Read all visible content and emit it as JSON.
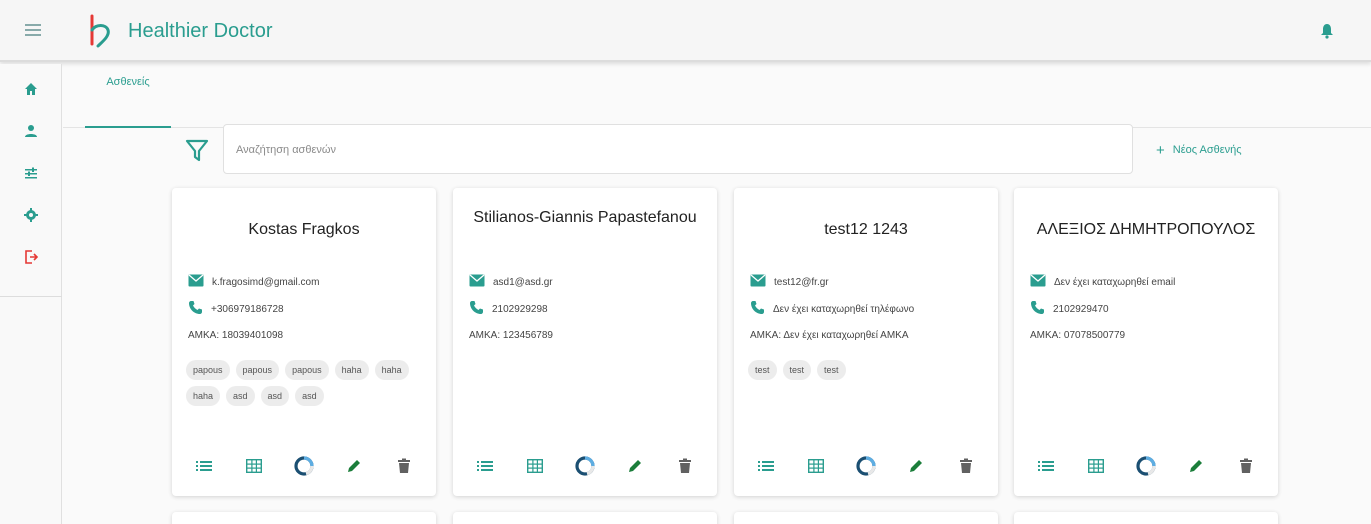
{
  "app": {
    "title": "Healthier Doctor"
  },
  "colors": {
    "accent": "#2a9d8f",
    "logout": "#e53935",
    "icon_gray": "#888888",
    "delete": "#616161",
    "edit": "#1b7d3a"
  },
  "icons": {
    "topbar": [
      "menu-icon",
      "logo-icon",
      "bell-icon"
    ],
    "sidebar": [
      "home-icon",
      "person-icon",
      "sliders-icon",
      "gear-icon",
      "logout-icon"
    ],
    "card_actions": [
      "list-icon",
      "table-icon",
      "progress-icon",
      "edit-icon",
      "delete-icon"
    ]
  },
  "tabs": [
    {
      "label": "Ασθενείς",
      "active": true
    }
  ],
  "search": {
    "placeholder": "Αναζήτηση ασθενών",
    "value": ""
  },
  "new_patient_label": "Νέος Ασθενής",
  "patients": [
    {
      "name": "Kostas Fragkos",
      "email": "k.fragosimd@gmail.com",
      "phone": "+306979186728",
      "amka": "ΑΜΚΑ: 18039401098",
      "tags": [
        "papous",
        "papous",
        "papous",
        "haha",
        "haha",
        "haha",
        "asd",
        "asd",
        "asd"
      ]
    },
    {
      "name": "Stilianos-Giannis Papastefanou",
      "email": "asd1@asd.gr",
      "phone": "2102929298",
      "amka": "ΑΜΚΑ: 123456789",
      "tags": []
    },
    {
      "name": "test12 1243",
      "email": "test12@fr.gr",
      "phone": "Δεν έχει καταχωρηθεί τηλέφωνο",
      "amka": "ΑΜΚΑ: Δεν έχει καταχωρηθεί ΑΜΚΑ",
      "tags": [
        "test",
        "test",
        "test"
      ]
    },
    {
      "name": "ΑΛΕΞΙΟΣ ΔΗΜΗΤΡΟΠΟΥΛΟΣ",
      "email": "Δεν έχει καταχωρηθεί email",
      "phone": "2102929470",
      "amka": "ΑΜΚΑ: 07078500779",
      "tags": []
    }
  ]
}
